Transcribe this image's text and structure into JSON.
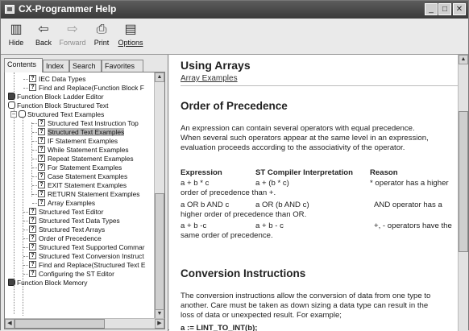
{
  "window": {
    "title": "CX-Programmer Help"
  },
  "toolbar": {
    "buttons": [
      {
        "label": "Hide"
      },
      {
        "label": "Back"
      },
      {
        "label": "Forward"
      },
      {
        "label": "Print"
      },
      {
        "label": "Options"
      }
    ]
  },
  "tabs": [
    "Contents",
    "Index",
    "Search",
    "Favorites"
  ],
  "tree": [
    {
      "label": "IEC Data Types"
    },
    {
      "label": "Find and Replace(Function Block F"
    },
    {
      "label": "Function Block Ladder Editor"
    },
    {
      "label": "Function Block Structured Text"
    },
    {
      "label": "Structured Text Examples"
    },
    {
      "label": "Structured Text Instruction Top"
    },
    {
      "label": "Structured Text Examples"
    },
    {
      "label": "IF Statement Examples"
    },
    {
      "label": "While Statement Examples"
    },
    {
      "label": "Repeat Statement Examples"
    },
    {
      "label": "For Statement Examples"
    },
    {
      "label": "Case Statement Examples"
    },
    {
      "label": "EXIT Statement Examples"
    },
    {
      "label": "RETURN Statement Examples"
    },
    {
      "label": "Array Examples"
    },
    {
      "label": "Structured Text Editor"
    },
    {
      "label": "Structured Text Data Types"
    },
    {
      "label": "Structured Text Arrays"
    },
    {
      "label": "Order of Precedence"
    },
    {
      "label": "Structured Text Supported Commar"
    },
    {
      "label": "Structured Text Conversion Instruct"
    },
    {
      "label": "Find and Replace(Structured Text E"
    },
    {
      "label": "Configuring the ST Editor"
    },
    {
      "label": "Function Block Memory"
    }
  ],
  "content": {
    "title": "Using Arrays",
    "link": "Array Examples",
    "section1": "Order of Precedence",
    "para1_line1": "An expression can contain several operators with equal precedence.",
    "para1_line2": "When several such operators appear at the same level in an expression,",
    "para1_line3": "evaluation proceeds according to the associativity of the operator.",
    "table": {
      "headers": [
        "Expression",
        "ST Compiler Interpretation",
        "Reason"
      ],
      "rows": [
        {
          "expr": "a + b * c",
          "interp": "a + (b * c)",
          "reason": "* operator has a higher",
          "cont": "order of precedence than +."
        },
        {
          "expr": "a OR b AND c",
          "interp": "a OR (b AND c)",
          "reason": "AND operator has a",
          "cont": "higher order of precedence than OR."
        },
        {
          "expr": "a + b -c",
          "interp": "a + b - c",
          "reason": "+, - operators have the",
          "cont": "same order of precedence."
        }
      ]
    },
    "section2": "Conversion Instructions",
    "para2_line1": "The conversion instructions allow the conversion of data from one type to",
    "para2_line2": "another. Care must be taken as down sizing a data type can result in the",
    "para2_line3": "loss of data or unexpected result. For example;",
    "code": "a := LINT_TO_INT(b);"
  }
}
